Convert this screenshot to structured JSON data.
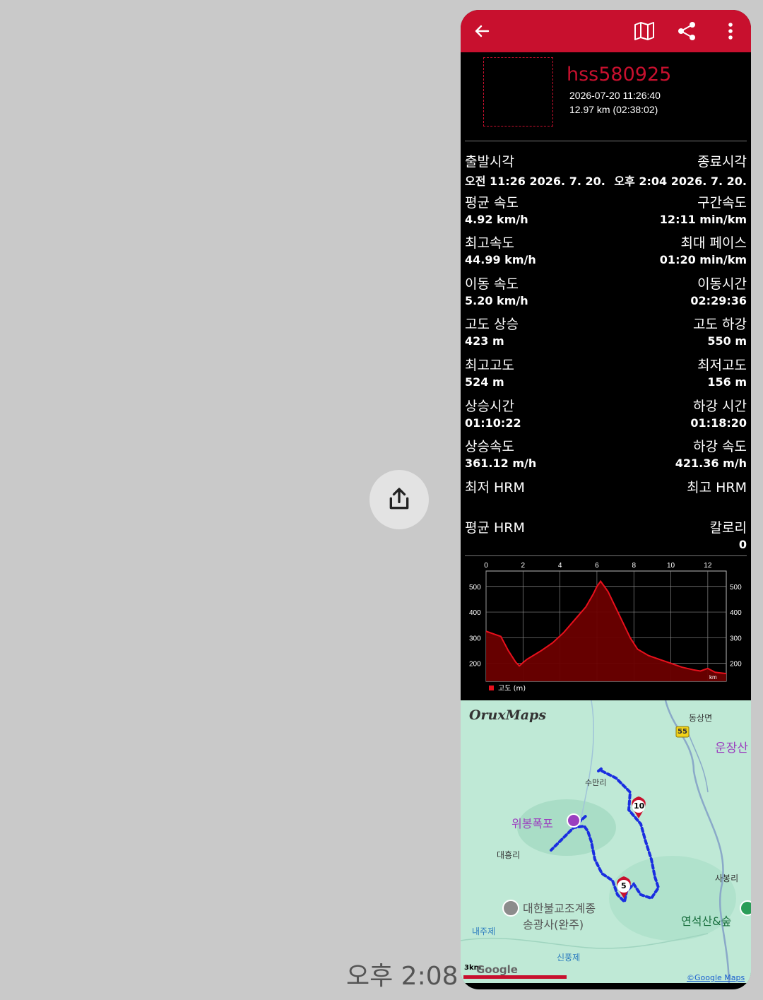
{
  "timestamp": "오후 2:08",
  "app": {
    "username": "hss580925",
    "datetime": "2026-07-20 11:26:40",
    "summary": "12.97 km (02:38:02)",
    "accent": "#c8102e"
  },
  "stats": [
    {
      "left_label": "출발시각",
      "left_value": "오전 11:26 2026. 7. 20.",
      "right_label": "종료시각",
      "right_value": "오후 2:04 2026. 7. 20."
    },
    {
      "left_label": "평균 속도",
      "left_value": "4.92 km/h",
      "right_label": "구간속도",
      "right_value": "12:11 min/km"
    },
    {
      "left_label": "최고속도",
      "left_value": "44.99 km/h",
      "right_label": "최대 페이스",
      "right_value": "01:20 min/km"
    },
    {
      "left_label": "이동 속도",
      "left_value": "5.20 km/h",
      "right_label": "이동시간",
      "right_value": "02:29:36"
    },
    {
      "left_label": "고도 상승",
      "left_value": "423 m",
      "right_label": "고도 하강",
      "right_value": "550 m"
    },
    {
      "left_label": "최고고도",
      "left_value": "524 m",
      "right_label": "최저고도",
      "right_value": "156 m"
    },
    {
      "left_label": "상승시간",
      "left_value": "01:10:22",
      "right_label": "하강 시간",
      "right_value": "01:18:20"
    },
    {
      "left_label": "상승속도",
      "left_value": "361.12 m/h",
      "right_label": "하강 속도",
      "right_value": "421.36 m/h"
    },
    {
      "left_label": "최저 HRM",
      "left_value": "",
      "right_label": "최고 HRM",
      "right_value": ""
    },
    {
      "left_label": "평균 HRM",
      "left_value": "",
      "right_label": "칼로리",
      "right_value": "0"
    }
  ],
  "chart_data": {
    "type": "area",
    "legend": "고도 (m)",
    "x_unit": "km",
    "xlim": [
      0,
      13
    ],
    "ylim": [
      130,
      560
    ],
    "x_ticks": [
      "0",
      "2",
      "4",
      "6",
      "8",
      "10",
      "12"
    ],
    "y_ticks": [
      "500",
      "400",
      "300",
      "200"
    ],
    "x": [
      0,
      0.4,
      0.8,
      1.2,
      1.6,
      1.8,
      2.2,
      3.0,
      3.6,
      4.2,
      4.8,
      5.4,
      5.8,
      6.0,
      6.2,
      6.6,
      7.0,
      7.4,
      7.8,
      8.2,
      8.8,
      9.4,
      10.0,
      10.6,
      11.2,
      11.6,
      12.0,
      12.4,
      13.0
    ],
    "series": [
      {
        "values": [
          325,
          315,
          305,
          250,
          205,
          190,
          215,
          250,
          280,
          320,
          370,
          420,
          470,
          500,
          520,
          480,
          420,
          360,
          300,
          255,
          230,
          215,
          200,
          185,
          175,
          170,
          180,
          165,
          160
        ]
      }
    ],
    "color": "#e8101c",
    "fill": "#6b0000",
    "grid": true
  },
  "map": {
    "brand": "OruxMaps",
    "labels": {
      "dongsang": "동상면",
      "route55": "55",
      "unjangsan": "운장산",
      "sumanri": "수만리",
      "wibong": "위봉폭포",
      "daeheungri": "대흥리",
      "sabongri": "사봉리",
      "temple1": "대한불교조계종",
      "temple2": "송광사(완주)",
      "yeonseok": "연석산&숲",
      "naeju": "내주제",
      "sinpung": "신풍제",
      "scale": "3km",
      "google": "Google",
      "copyright": "©Google Maps",
      "pin10": "10",
      "pin5": "5"
    }
  }
}
